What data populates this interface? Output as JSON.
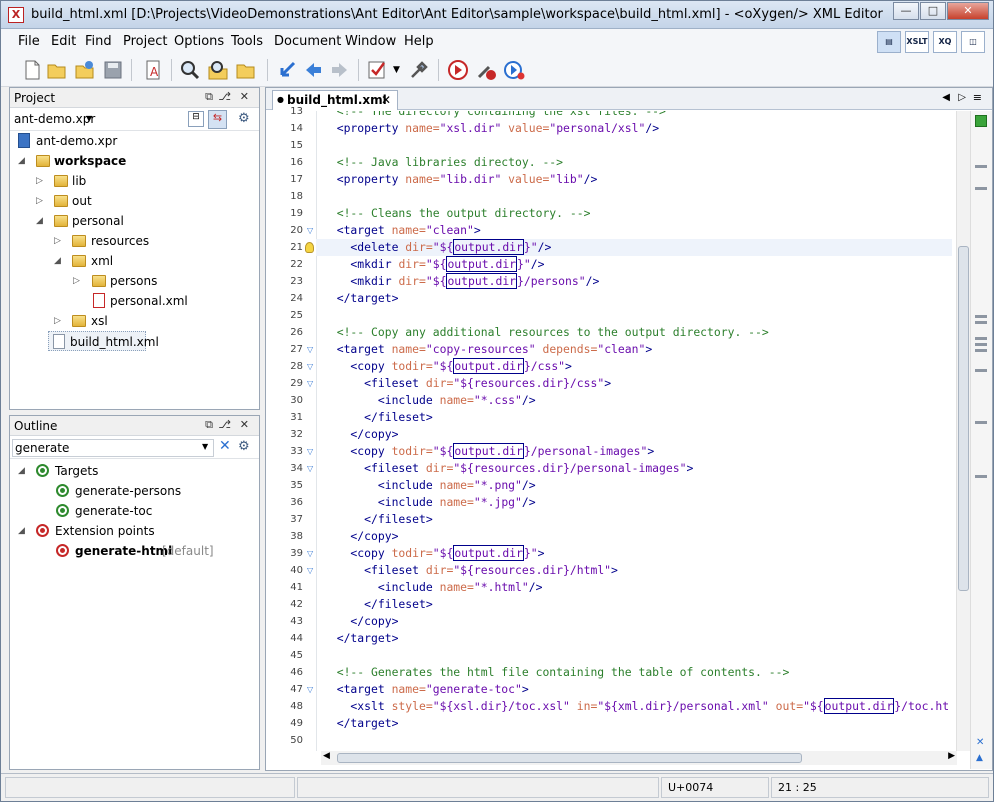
{
  "window": {
    "title": "build_html.xml [D:\\Projects\\VideoDemonstrations\\Ant Editor\\Ant Editor\\sample\\workspace\\build_html.xml] - <oXygen/> XML Editor",
    "app_icon": "oxygen-logo-icon"
  },
  "menu": [
    "File",
    "Edit",
    "Find",
    "Project",
    "Options",
    "Tools",
    "Document",
    "Window",
    "Help"
  ],
  "perspective_buttons": [
    {
      "label": "",
      "icon": "editor-perspective-icon",
      "selected": true
    },
    {
      "label": "XSLT",
      "icon": "xslt-debugger-icon"
    },
    {
      "label": "XQ",
      "icon": "xquery-debugger-icon"
    },
    {
      "label": "",
      "icon": "database-perspective-icon"
    }
  ],
  "toolbar": {
    "icons": [
      "new-file-icon",
      "open-file-icon",
      "open-url-icon",
      "save-icon",
      "reformat-icon",
      "find-icon",
      "find-in-files-icon",
      "open-folder-icon",
      "back-arrow-icon",
      "previous-icon",
      "next-icon",
      "validate-icon",
      "dropdown-arrow-icon",
      "configure-transformation-icon",
      "apply-transformation-icon",
      "transform-settings-icon",
      "debug-transformation-icon"
    ]
  },
  "project_panel": {
    "title": "Project",
    "project_selector": "ant-demo.xpr",
    "tree": [
      {
        "label": "ant-demo.xpr",
        "level": 0,
        "type": "project"
      },
      {
        "label": "workspace",
        "level": 0,
        "type": "folder",
        "expanded": true,
        "bold": true
      },
      {
        "label": "lib",
        "level": 1,
        "type": "folder",
        "expanded": false
      },
      {
        "label": "out",
        "level": 1,
        "type": "folder",
        "expanded": false
      },
      {
        "label": "personal",
        "level": 1,
        "type": "folder",
        "expanded": true
      },
      {
        "label": "resources",
        "level": 2,
        "type": "folder",
        "expanded": false
      },
      {
        "label": "xml",
        "level": 2,
        "type": "folder",
        "expanded": true
      },
      {
        "label": "persons",
        "level": 3,
        "type": "folder",
        "expanded": false
      },
      {
        "label": "personal.xml",
        "level": 3,
        "type": "xml-file"
      },
      {
        "label": "xsl",
        "level": 2,
        "type": "folder",
        "expanded": false
      },
      {
        "label": "build_html.xml",
        "level": 1,
        "type": "ant-file",
        "selected": true
      }
    ]
  },
  "outline_panel": {
    "title": "Outline",
    "filter_value": "generate",
    "tree": [
      {
        "label": "Targets",
        "level": 0,
        "type": "group-green"
      },
      {
        "label": "generate-persons",
        "level": 1,
        "type": "target"
      },
      {
        "label": "generate-toc",
        "level": 1,
        "type": "target"
      },
      {
        "label": "Extension points",
        "level": 0,
        "type": "group-red"
      },
      {
        "label": "generate-html",
        "suffix": "[default]",
        "level": 1,
        "type": "extension",
        "bold": true
      }
    ]
  },
  "editor": {
    "tab_label": "build_html.xml",
    "current_line": 21,
    "lines": [
      {
        "n": "13",
        "fold": false,
        "tokens": [
          [
            "c",
            "  <!-- The directory containing the xsl files. -->"
          ]
        ]
      },
      {
        "n": "14",
        "fold": false,
        "tokens": [
          [
            "t",
            "  <property "
          ],
          [
            "a",
            "name="
          ],
          [
            "v",
            "\"xsl.dir\""
          ],
          [
            "a",
            " value="
          ],
          [
            "v",
            "\"personal/xsl\""
          ],
          [
            "t",
            "/>"
          ]
        ]
      },
      {
        "n": "15",
        "fold": false,
        "tokens": []
      },
      {
        "n": "16",
        "fold": false,
        "tokens": [
          [
            "c",
            "  <!-- Java libraries directoy. -->"
          ]
        ]
      },
      {
        "n": "17",
        "fold": false,
        "tokens": [
          [
            "t",
            "  <property "
          ],
          [
            "a",
            "name="
          ],
          [
            "v",
            "\"lib.dir\""
          ],
          [
            "a",
            " value="
          ],
          [
            "v",
            "\"lib\""
          ],
          [
            "t",
            "/>"
          ]
        ]
      },
      {
        "n": "18",
        "fold": false,
        "tokens": []
      },
      {
        "n": "19",
        "fold": false,
        "tokens": [
          [
            "c",
            "  <!-- Cleans the output directory. -->"
          ]
        ]
      },
      {
        "n": "20",
        "fold": true,
        "tokens": [
          [
            "t",
            "  <target "
          ],
          [
            "a",
            "name="
          ],
          [
            "v",
            "\"clean\""
          ],
          [
            "t",
            ">"
          ]
        ]
      },
      {
        "n": "21",
        "fold": false,
        "bulb": true,
        "tokens": [
          [
            "t",
            "    <delete "
          ],
          [
            "a",
            "dir="
          ],
          [
            "v",
            "\"${"
          ],
          [
            "h",
            "output.dir"
          ],
          [
            "v",
            "}\""
          ],
          [
            "t",
            "/>"
          ]
        ]
      },
      {
        "n": "22",
        "fold": false,
        "tokens": [
          [
            "t",
            "    <mkdir "
          ],
          [
            "a",
            "dir="
          ],
          [
            "v",
            "\"${"
          ],
          [
            "h",
            "output.dir"
          ],
          [
            "v",
            "}\""
          ],
          [
            "t",
            "/>"
          ]
        ]
      },
      {
        "n": "23",
        "fold": false,
        "tokens": [
          [
            "t",
            "    <mkdir "
          ],
          [
            "a",
            "dir="
          ],
          [
            "v",
            "\"${"
          ],
          [
            "h",
            "output.dir"
          ],
          [
            "v",
            "}/persons\""
          ],
          [
            "t",
            "/>"
          ]
        ]
      },
      {
        "n": "24",
        "fold": false,
        "tokens": [
          [
            "t",
            "  </target>"
          ]
        ]
      },
      {
        "n": "25",
        "fold": false,
        "tokens": []
      },
      {
        "n": "26",
        "fold": false,
        "tokens": [
          [
            "c",
            "  <!-- Copy any additional resources to the output directory. -->"
          ]
        ]
      },
      {
        "n": "27",
        "fold": true,
        "tokens": [
          [
            "t",
            "  <target "
          ],
          [
            "a",
            "name="
          ],
          [
            "v",
            "\"copy-resources\""
          ],
          [
            "a",
            " depends="
          ],
          [
            "v",
            "\"clean\""
          ],
          [
            "t",
            ">"
          ]
        ]
      },
      {
        "n": "28",
        "fold": true,
        "tokens": [
          [
            "t",
            "    <copy "
          ],
          [
            "a",
            "todir="
          ],
          [
            "v",
            "\"${"
          ],
          [
            "h",
            "output.dir"
          ],
          [
            "v",
            "}/css\""
          ],
          [
            "t",
            ">"
          ]
        ]
      },
      {
        "n": "29",
        "fold": true,
        "tokens": [
          [
            "t",
            "      <fileset "
          ],
          [
            "a",
            "dir="
          ],
          [
            "v",
            "\"${resources.dir}/css\""
          ],
          [
            "t",
            ">"
          ]
        ]
      },
      {
        "n": "30",
        "fold": false,
        "tokens": [
          [
            "t",
            "        <include "
          ],
          [
            "a",
            "name="
          ],
          [
            "v",
            "\"*.css\""
          ],
          [
            "t",
            "/>"
          ]
        ]
      },
      {
        "n": "31",
        "fold": false,
        "tokens": [
          [
            "t",
            "      </fileset>"
          ]
        ]
      },
      {
        "n": "32",
        "fold": false,
        "tokens": [
          [
            "t",
            "    </copy>"
          ]
        ]
      },
      {
        "n": "33",
        "fold": true,
        "tokens": [
          [
            "t",
            "    <copy "
          ],
          [
            "a",
            "todir="
          ],
          [
            "v",
            "\"${"
          ],
          [
            "h",
            "output.dir"
          ],
          [
            "v",
            "}/personal-images\""
          ],
          [
            "t",
            ">"
          ]
        ]
      },
      {
        "n": "34",
        "fold": true,
        "tokens": [
          [
            "t",
            "      <fileset "
          ],
          [
            "a",
            "dir="
          ],
          [
            "v",
            "\"${resources.dir}/personal-images\""
          ],
          [
            "t",
            ">"
          ]
        ]
      },
      {
        "n": "35",
        "fold": false,
        "tokens": [
          [
            "t",
            "        <include "
          ],
          [
            "a",
            "name="
          ],
          [
            "v",
            "\"*.png\""
          ],
          [
            "t",
            "/>"
          ]
        ]
      },
      {
        "n": "36",
        "fold": false,
        "tokens": [
          [
            "t",
            "        <include "
          ],
          [
            "a",
            "name="
          ],
          [
            "v",
            "\"*.jpg\""
          ],
          [
            "t",
            "/>"
          ]
        ]
      },
      {
        "n": "37",
        "fold": false,
        "tokens": [
          [
            "t",
            "      </fileset>"
          ]
        ]
      },
      {
        "n": "38",
        "fold": false,
        "tokens": [
          [
            "t",
            "    </copy>"
          ]
        ]
      },
      {
        "n": "39",
        "fold": true,
        "tokens": [
          [
            "t",
            "    <copy "
          ],
          [
            "a",
            "todir="
          ],
          [
            "v",
            "\"${"
          ],
          [
            "h",
            "output.dir"
          ],
          [
            "v",
            "}\""
          ],
          [
            "t",
            ">"
          ]
        ]
      },
      {
        "n": "40",
        "fold": true,
        "tokens": [
          [
            "t",
            "      <fileset "
          ],
          [
            "a",
            "dir="
          ],
          [
            "v",
            "\"${resources.dir}/html\""
          ],
          [
            "t",
            ">"
          ]
        ]
      },
      {
        "n": "41",
        "fold": false,
        "tokens": [
          [
            "t",
            "        <include "
          ],
          [
            "a",
            "name="
          ],
          [
            "v",
            "\"*.html\""
          ],
          [
            "t",
            "/>"
          ]
        ]
      },
      {
        "n": "42",
        "fold": false,
        "tokens": [
          [
            "t",
            "      </fileset>"
          ]
        ]
      },
      {
        "n": "43",
        "fold": false,
        "tokens": [
          [
            "t",
            "    </copy>"
          ]
        ]
      },
      {
        "n": "44",
        "fold": false,
        "tokens": [
          [
            "t",
            "  </target>"
          ]
        ]
      },
      {
        "n": "45",
        "fold": false,
        "tokens": []
      },
      {
        "n": "46",
        "fold": false,
        "tokens": [
          [
            "c",
            "  <!-- Generates the html file containing the table of contents. -->"
          ]
        ]
      },
      {
        "n": "47",
        "fold": true,
        "tokens": [
          [
            "t",
            "  <target "
          ],
          [
            "a",
            "name="
          ],
          [
            "v",
            "\"generate-toc\""
          ],
          [
            "t",
            ">"
          ]
        ]
      },
      {
        "n": "48",
        "fold": false,
        "tokens": [
          [
            "t",
            "    <xslt "
          ],
          [
            "a",
            "style="
          ],
          [
            "v",
            "\"${xsl.dir}/toc.xsl\""
          ],
          [
            "a",
            " in="
          ],
          [
            "v",
            "\"${xml.dir}/personal.xml\""
          ],
          [
            "a",
            " out="
          ],
          [
            "v",
            "\"${"
          ],
          [
            "h",
            "output.dir"
          ],
          [
            "v",
            "}/toc.ht"
          ]
        ]
      },
      {
        "n": "49",
        "fold": false,
        "tokens": [
          [
            "t",
            "  </target>"
          ]
        ]
      },
      {
        "n": "50",
        "fold": false,
        "tokens": []
      }
    ]
  },
  "status_bar": {
    "unicode": "U+0074",
    "position": "21 : 25"
  },
  "colors": {
    "comment": "#2c7f2c",
    "tag": "#00008b",
    "attribute": "#cc6b4a",
    "value": "#6a0dad",
    "selection_box": "#00008b"
  }
}
